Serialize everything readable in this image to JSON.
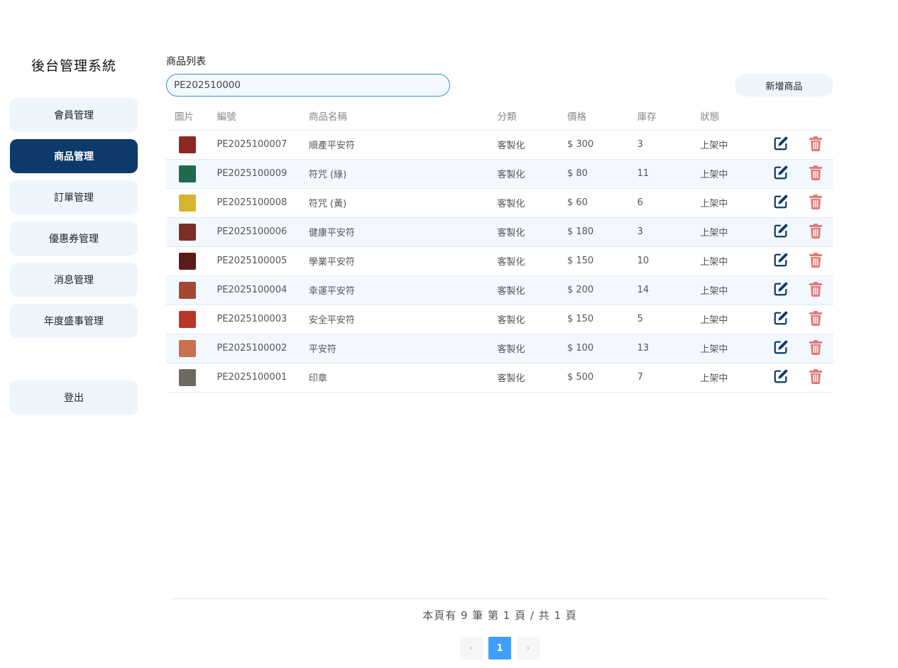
{
  "sidebar": {
    "brand": "後台管理系統",
    "items": [
      {
        "label": "會員管理",
        "active": false
      },
      {
        "label": "商品管理",
        "active": true
      },
      {
        "label": "訂單管理",
        "active": false
      },
      {
        "label": "優惠券管理",
        "active": false
      },
      {
        "label": "消息管理",
        "active": false
      },
      {
        "label": "年度盛事管理",
        "active": false
      }
    ],
    "logout_label": "登出"
  },
  "main": {
    "title": "商品列表",
    "search_value": "PE202510000",
    "add_label": "新增商品",
    "columns": [
      "圖片",
      "編號",
      "商品名稱",
      "分類",
      "價格",
      "庫存",
      "狀態"
    ],
    "rows": [
      {
        "id": "PE2025100007",
        "name": "順產平安符",
        "category": "客製化",
        "price": "$ 300",
        "stock": "3",
        "status": "上架中",
        "thumb_color": "#8a2a22"
      },
      {
        "id": "PE2025100009",
        "name": "符咒 (綠)",
        "category": "客製化",
        "price": "$ 80",
        "stock": "11",
        "status": "上架中",
        "thumb_color": "#1f6b52"
      },
      {
        "id": "PE2025100008",
        "name": "符咒 (黃)",
        "category": "客製化",
        "price": "$ 60",
        "stock": "6",
        "status": "上架中",
        "thumb_color": "#d8b42e"
      },
      {
        "id": "PE2025100006",
        "name": "健康平安符",
        "category": "客製化",
        "price": "$ 180",
        "stock": "3",
        "status": "上架中",
        "thumb_color": "#7d2f24"
      },
      {
        "id": "PE2025100005",
        "name": "學業平安符",
        "category": "客製化",
        "price": "$ 150",
        "stock": "10",
        "status": "上架中",
        "thumb_color": "#5a1c18"
      },
      {
        "id": "PE2025100004",
        "name": "幸運平安符",
        "category": "客製化",
        "price": "$ 200",
        "stock": "14",
        "status": "上架中",
        "thumb_color": "#a04a36"
      },
      {
        "id": "PE2025100003",
        "name": "安全平安符",
        "category": "客製化",
        "price": "$ 150",
        "stock": "5",
        "status": "上架中",
        "thumb_color": "#b8362c"
      },
      {
        "id": "PE2025100002",
        "name": "平安符",
        "category": "客製化",
        "price": "$ 100",
        "stock": "13",
        "status": "上架中",
        "thumb_color": "#c9704e"
      },
      {
        "id": "PE2025100001",
        "name": "印章",
        "category": "客製化",
        "price": "$ 500",
        "stock": "7",
        "status": "上架中",
        "thumb_color": "#6e6a62"
      }
    ]
  },
  "pager": {
    "info": "本頁有 9 筆 第 1 頁 / 共 1 頁",
    "current": "1",
    "prev": "‹",
    "next": "›"
  },
  "colors": {
    "brand_navy": "#0d3a6a",
    "edit_icon": "#0d3a6a",
    "delete_icon": "#e07a7a",
    "page_active": "#409eff"
  }
}
